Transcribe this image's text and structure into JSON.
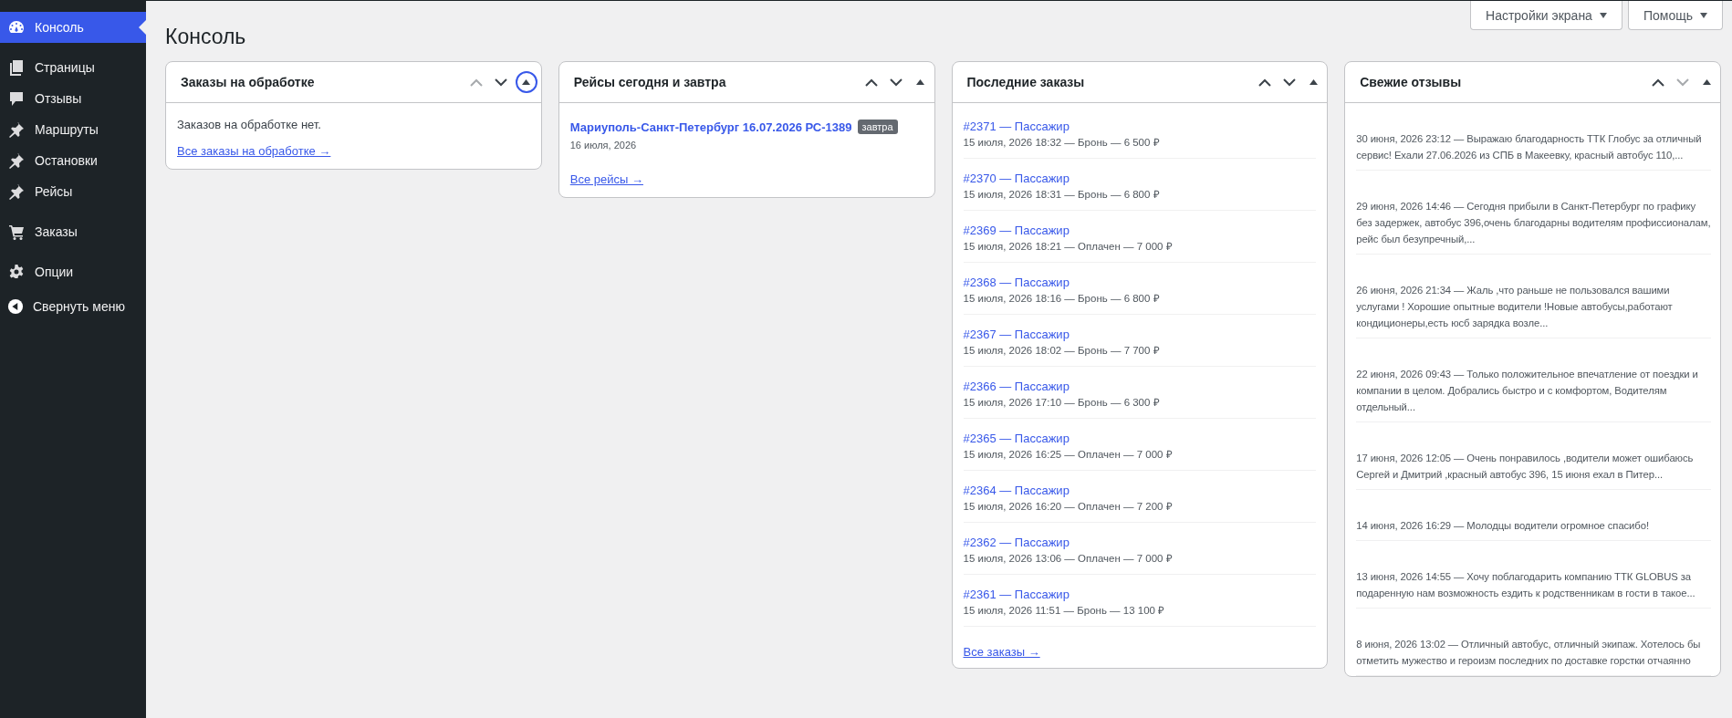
{
  "sidebar": {
    "groups": [
      {
        "items": [
          {
            "label": "Консоль",
            "selected": true
          }
        ]
      },
      {
        "items": [
          {
            "label": "Страницы",
            "selected": false
          },
          {
            "label": "Отзывы",
            "selected": false
          },
          {
            "label": "Маршруты",
            "selected": false
          },
          {
            "label": "Остановки",
            "selected": false
          },
          {
            "label": "Рейсы",
            "selected": false
          }
        ]
      },
      {
        "items": [
          {
            "label": "Заказы",
            "selected": false
          }
        ]
      },
      {
        "items": [
          {
            "label": "Опции",
            "selected": false
          }
        ]
      }
    ],
    "collapse_button": {
      "label": "Свернуть меню"
    }
  },
  "header": {
    "screen_options_button": "Настройки экрана",
    "help_button": "Помощь"
  },
  "page_title": "Консоль",
  "widgets": [
    {
      "kind": "pending",
      "title": "Заказы на обработке",
      "move_up": {
        "disabled": true
      },
      "move_down": {
        "disabled": false
      },
      "toggle": {
        "focused": true
      },
      "empty_text": "Заказов на обработке нет.",
      "link": "Все заказы на обработке →"
    },
    {
      "kind": "trips",
      "title": "Рейсы сегодня и завтра",
      "move_up": {
        "disabled": false
      },
      "move_down": {
        "disabled": false
      },
      "toggle": {
        "focused": false
      },
      "trips": [
        {
          "title": "Мариуполь-Санкт-Петербург 16.07.2026 РС-1389",
          "badge": "завтра",
          "date": "16 июля, 2026"
        }
      ],
      "link": "Все рейсы →"
    },
    {
      "kind": "orders",
      "title": "Последние заказы",
      "move_up": {
        "disabled": false
      },
      "move_down": {
        "disabled": false
      },
      "toggle": {
        "focused": false
      },
      "orders": [
        {
          "title": "#2371 — Пассажир",
          "meta": "15 июля, 2026 18:32 — Бронь — 6 500 ₽"
        },
        {
          "title": "#2370 — Пассажир",
          "meta": "15 июля, 2026 18:31 — Бронь — 6 800 ₽"
        },
        {
          "title": "#2369 — Пассажир",
          "meta": "15 июля, 2026 18:21 — Оплачен — 7 000 ₽"
        },
        {
          "title": "#2368 — Пассажир",
          "meta": "15 июля, 2026 18:16 — Бронь — 6 800 ₽"
        },
        {
          "title": "#2367 — Пассажир",
          "meta": "15 июля, 2026 18:02 — Бронь — 7 700 ₽"
        },
        {
          "title": "#2366 — Пассажир",
          "meta": "15 июля, 2026 17:10 — Бронь — 6 300 ₽"
        },
        {
          "title": "#2365 — Пассажир",
          "meta": "15 июля, 2026 16:25 — Оплачен — 7 000 ₽"
        },
        {
          "title": "#2364 — Пассажир",
          "meta": "15 июля, 2026 16:20 — Оплачен — 7 200 ₽"
        },
        {
          "title": "#2362 — Пассажир",
          "meta": "15 июля, 2026 13:06 — Оплачен — 7 000 ₽"
        },
        {
          "title": "#2361 — Пассажир",
          "meta": "15 июля, 2026 11:51 — Бронь — 13 100 ₽"
        }
      ],
      "link": "Все заказы →"
    },
    {
      "kind": "reviews",
      "title": "Свежие отзывы",
      "move_up": {
        "disabled": false
      },
      "move_down": {
        "disabled": true
      },
      "toggle": {
        "focused": false
      },
      "reviews": [
        {
          "text": "30 июня, 2026 23:12 — Выражаю благодарность ТТК Глобус за отличный сервис! Ехали 27.06.2026 из СПБ в Макеевку, красный автобус 110,..."
        },
        {
          "text": "29 июня, 2026 14:46 — Сегодня прибыли в Санкт-Петербург по графику без задержек, автобус 396,очень благодарны водителям профиссионалам, рейс был безупречный,..."
        },
        {
          "text": "26 июня, 2026 21:34 — Жаль ,что раньше не пользовался вашими услугами ! Хорошие опытные водители !Новые автобусы,работают кондиционеры,есть юсб зарядка возле..."
        },
        {
          "text": "22 июня, 2026 09:43 — Только положительное впечатление от поездки и компании в целом. Добрались быстро и с комфортом, Водителям отдельный..."
        },
        {
          "text": "17 июня, 2026 12:05 — Очень понравилось ,водители может ошибаюсь Сергей и Дмитрий ,красный автобус 396, 15 июня ехал в Питер..."
        },
        {
          "text": "14 июня, 2026 16:29 — Молодцы водители огромное спасибо!"
        },
        {
          "text": "13 июня, 2026 14:55 — Хочу поблагодарить компанию ТТК GLOBUS за подаренную нам возможность ездить к родственникам в гости в такое..."
        },
        {
          "text": "8 июня, 2026 13:02 — Отличный автобус, отличный экипаж. Хотелось бы отметить мужество и героизм последних по доставке горстки отчаянно"
        }
      ]
    }
  ]
}
